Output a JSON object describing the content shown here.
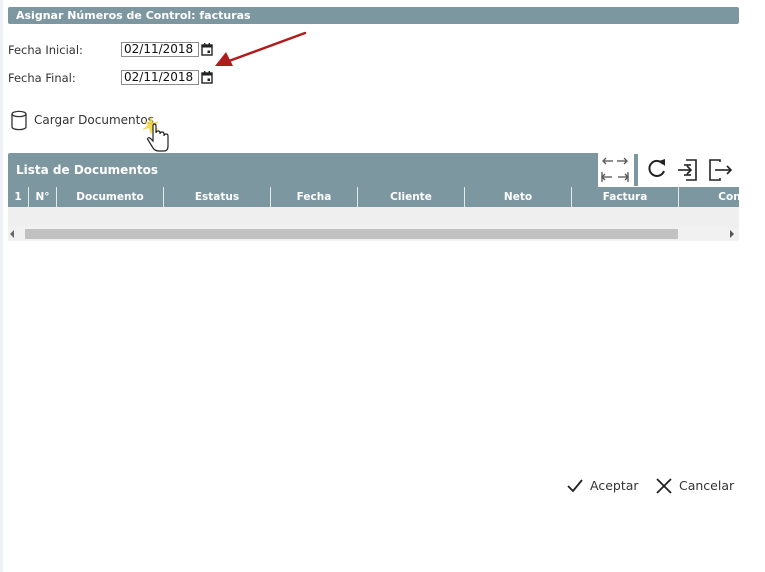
{
  "window": {
    "title": "Asignar Números de Control: facturas"
  },
  "filters": {
    "start": {
      "label": "Fecha Inicial:",
      "value": "02/11/2018",
      "icon": "calendar-icon"
    },
    "end": {
      "label": "Fecha Final:",
      "value": "02/11/2018",
      "icon": "calendar-icon"
    }
  },
  "load_button": {
    "label": "Cargar Documentos",
    "icon": "database-icon"
  },
  "list": {
    "title": "Lista de Documentos",
    "columns": [
      "1",
      "N°",
      "Documento",
      "Estatus",
      "Fecha",
      "Cliente",
      "Neto",
      "Factura",
      "Cont"
    ],
    "rows": []
  },
  "toolbar": {
    "icons": [
      "expand-columns-icon",
      "collapse-columns-icon",
      "refresh-icon",
      "import-icon",
      "export-icon"
    ]
  },
  "actions": {
    "accept": "Aceptar",
    "cancel": "Cancelar"
  },
  "colors": {
    "header": "#7d97a1",
    "arrow": "#b01c1c"
  }
}
